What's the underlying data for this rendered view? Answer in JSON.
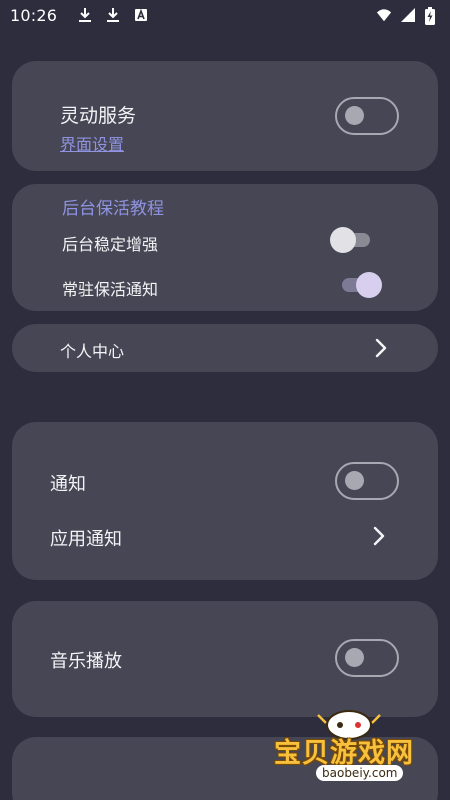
{
  "status_bar": {
    "time": "10:26",
    "icons_left": [
      "download-icon",
      "download-icon",
      "a-box-icon"
    ],
    "icons_right": [
      "wifi-icon",
      "signal-icon",
      "battery-charging-icon"
    ]
  },
  "card_dynamic": {
    "title": "灵动服务",
    "link": "界面设置",
    "toggle_on": false
  },
  "card_background": {
    "tutorial": "后台保活教程",
    "stable_label": "后台稳定增强",
    "stable_on": false,
    "resident_label": "常驻保活通知",
    "resident_on": true
  },
  "personal_center": {
    "label": "个人中心",
    "icon": "chevron-right-icon"
  },
  "card_notify": {
    "notify_label": "通知",
    "notify_on": false,
    "app_notify_label": "应用通知"
  },
  "card_music": {
    "music_label": "音乐播放",
    "music_on": false
  },
  "watermark": {
    "title": "宝贝游戏网",
    "url": "baobeiy.com"
  },
  "colors": {
    "background": "#2d2d3d",
    "card": "#464654",
    "accent": "#8f93e0",
    "switch_on_thumb": "#d8cfee"
  }
}
